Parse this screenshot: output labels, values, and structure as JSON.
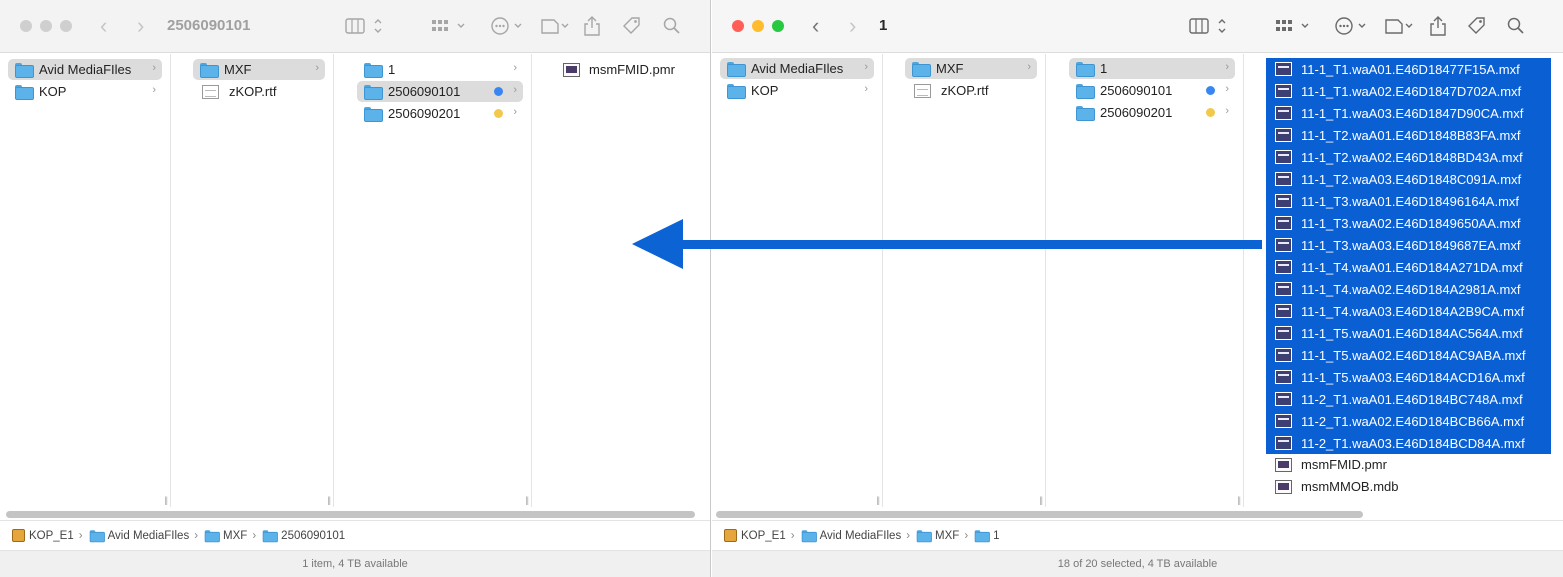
{
  "left_window": {
    "title": "2506090101",
    "col1": [
      {
        "label": "Avid MediaFIles",
        "selected": true
      },
      {
        "label": "KOP"
      }
    ],
    "col2": [
      {
        "label": "MXF",
        "selected": true
      },
      {
        "label": "zKOP.rtf"
      }
    ],
    "col3": [
      {
        "label": "1"
      },
      {
        "label": "2506090101",
        "selected": true,
        "tag": "#3a86f0"
      },
      {
        "label": "2506090201",
        "tag": "#f2c94c"
      }
    ],
    "col4": [
      {
        "label": "msmFMID.pmr"
      }
    ],
    "path": [
      "KOP_E1",
      "Avid MediaFIles",
      "MXF",
      "2506090101"
    ],
    "status": "1 item, 4 TB available"
  },
  "right_window": {
    "title": "1",
    "col1": [
      {
        "label": "Avid MediaFIles",
        "selected": true
      },
      {
        "label": "KOP"
      }
    ],
    "col2": [
      {
        "label": "MXF",
        "selected": true
      },
      {
        "label": "zKOP.rtf"
      }
    ],
    "col3": [
      {
        "label": "1",
        "selected": true
      },
      {
        "label": "2506090101",
        "tag": "#3a86f0"
      },
      {
        "label": "2506090201",
        "tag": "#f2c94c"
      }
    ],
    "files": [
      "11-1_T1.waA01.E46D18477F15A.mxf",
      "11-1_T1.waA02.E46D1847D702A.mxf",
      "11-1_T1.waA03.E46D1847D90CA.mxf",
      "11-1_T2.waA01.E46D1848B83FA.mxf",
      "11-1_T2.waA02.E46D1848BD43A.mxf",
      "11-1_T2.waA03.E46D1848C091A.mxf",
      "11-1_T3.waA01.E46D18496164A.mxf",
      "11-1_T3.waA02.E46D1849650AA.mxf",
      "11-1_T3.waA03.E46D1849687EA.mxf",
      "11-1_T4.waA01.E46D184A271DA.mxf",
      "11-1_T4.waA02.E46D184A2981A.mxf",
      "11-1_T4.waA03.E46D184A2B9CA.mxf",
      "11-1_T5.waA01.E46D184AC564A.mxf",
      "11-1_T5.waA02.E46D184AC9ABA.mxf",
      "11-1_T5.waA03.E46D184ACD16A.mxf",
      "11-2_T1.waA01.E46D184BC748A.mxf",
      "11-2_T1.waA02.E46D184BCB66A.mxf",
      "11-2_T1.waA03.E46D184BCD84A.mxf"
    ],
    "other_files": [
      "msmFMID.pmr",
      "msmMMOB.mdb"
    ],
    "path": [
      "KOP_E1",
      "Avid MediaFIles",
      "MXF",
      "1"
    ],
    "status": "18 of 20 selected, 4 TB available"
  },
  "colors": {
    "selection_blue": "#0a5fd3",
    "arrow_blue": "#0b63d4",
    "close": "#ff5f57",
    "minimize": "#febc2e",
    "zoom": "#28c840"
  }
}
